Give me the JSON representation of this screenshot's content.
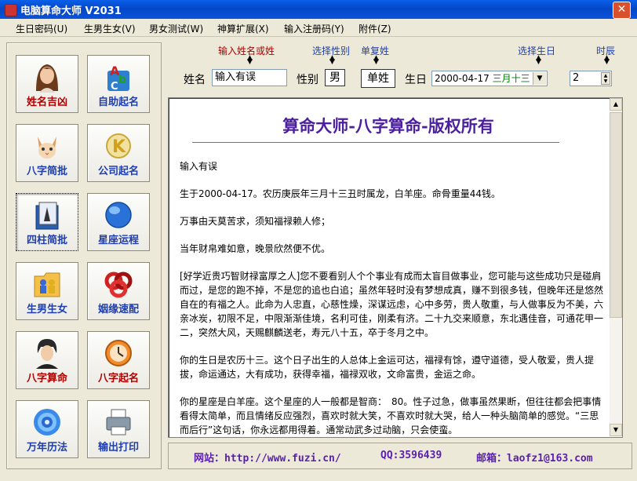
{
  "window": {
    "title": "电脑算命大师 V2031",
    "close_glyph": "✕"
  },
  "menu": [
    "生日密码(U)",
    "生男生女(V)",
    "男女测试(W)",
    "神算扩展(X)",
    "输入注册码(Y)",
    "附件(Z)"
  ],
  "tiles": [
    {
      "label": "姓名吉凶",
      "icon": "woman-portrait-icon"
    },
    {
      "label": "自助起名",
      "icon": "abc-letters-icon"
    },
    {
      "label": "八字简批",
      "icon": "cat-icon"
    },
    {
      "label": "公司起名",
      "icon": "gold-k-icon"
    },
    {
      "label": "四柱简批",
      "icon": "book-figure-icon"
    },
    {
      "label": "星座运程",
      "icon": "blue-globe-icon"
    },
    {
      "label": "生男生女",
      "icon": "folder-people-icon"
    },
    {
      "label": "姻缘速配",
      "icon": "red-knot-icon"
    },
    {
      "label": "八字算命",
      "icon": "man-portrait-icon"
    },
    {
      "label": "八字起名",
      "icon": "clock-icon"
    },
    {
      "label": "万年历法",
      "icon": "blue-target-icon"
    },
    {
      "label": "输出打印",
      "icon": "printer-icon"
    }
  ],
  "form": {
    "hint_name": "输入姓名或姓",
    "hint_gender": "选择性别",
    "hint_single": "单复姓",
    "hint_birthday": "选择生日",
    "hint_hour": "时辰",
    "name_label": "姓名",
    "name_value": "输入有误",
    "gender_label": "性别",
    "gender_value": "男",
    "surname_button": "单姓",
    "birthday_label": "生日",
    "birthday_value": "2000-04-17",
    "lunar_value": "三月十三",
    "hour_value": "2"
  },
  "content": {
    "heading": "算命大师-八字算命-版权所有",
    "paragraphs": [
      "输入有误",
      "生于2000-04-17。农历庚辰年三月十三丑时属龙，白羊座。命骨重量44钱。",
      "万事由天莫苦求，须知福禄赖人修；",
      "当年财帛难如意，晚景欣然便不优。",
      "[好学近贵巧智财禄富厚之人]您不要看别人个个事业有成而太盲目做事业，您可能与这些成功只是碰肩而过，是您的跑不掉，不是您的追也白追；虽然年轻时没有梦想成真，赚不到很多钱，但晚年还是悠然自在的有福之人。此命为人忠直，心慈性燥，深谋远虑，心中多劳，贵人敬重，与人做事反为不美，六亲冰炭，初限不足，中限渐渐佳境，名利可佳，刚柔有济。二十九交来顺意，东北遇佳音，可通花甲一二，突然大风，天赐麒麟送老，寿元八十五，卒于冬月之中。",
      "你的生日是农历十三。这个日子出生的人总体上金运可达，福禄有馀，遵守道德，受人敬爱，贵人提拔，命运通达，大有成功，获得幸福，福禄双收，文命富贵，金运之命。",
      "你的星座是白羊座。这个星座的人一般都是智商：　80。性子过急，做事虽然果断，但往往都会把事情看得太简单，而且情绪反应强烈，喜欢时就大笑，不喜欢时就大哭，给人一种头脑简单的感觉。“三思而后行”这句话，你永远都用得着。通常动武多过动脑，只会使蛮。"
    ]
  },
  "footer": {
    "website": "网站：http://www.fuzi.cn/",
    "qq": "QQ:3596439",
    "email": "邮箱：laofz1@163.com"
  }
}
